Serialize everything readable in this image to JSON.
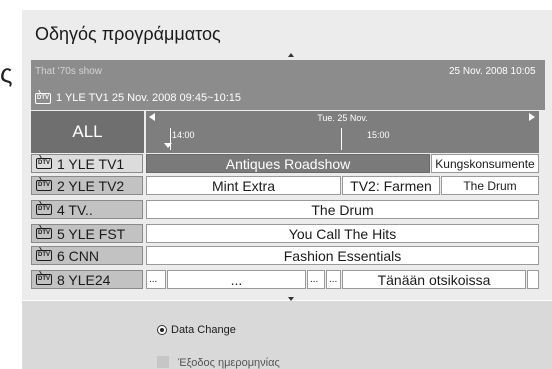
{
  "title": "Οδηγός προγράμματος",
  "left_glyph": "ς",
  "info": {
    "show": "That '70s show",
    "datetime": "25 Nov. 2008 10:05",
    "channel_line": "1 YLE TV1 25 Nov. 2008 09:45~10:15"
  },
  "filter": {
    "all_label": "ALL"
  },
  "timeline": {
    "date": "Tue. 25 Nov.",
    "times": [
      "14:00",
      "15:00"
    ]
  },
  "dtv_icon_text": "DTV",
  "channels": [
    {
      "label": "1  YLE TV1",
      "icon": "dtv-icon"
    },
    {
      "label": "2  YLE TV2",
      "icon": "dtv-icon"
    },
    {
      "label": "4  TV..",
      "icon": "dtv-icon"
    },
    {
      "label": "5  YLE FST",
      "icon": "dtv-icon"
    },
    {
      "label": "6  CNN",
      "icon": "dtv-icon"
    },
    {
      "label": "8  YLE24",
      "icon": "dtv-icon"
    }
  ],
  "programs": {
    "row1": [
      "Antiques Roadshow",
      "Kungskonsumente"
    ],
    "row2": [
      "Mint Extra",
      "TV2: Farmen",
      "The Drum"
    ],
    "row3": [
      "The Drum"
    ],
    "row4": [
      "You Call The Hits"
    ],
    "row5": [
      "Fashion Essentials"
    ],
    "row6": [
      "...",
      "...",
      "...",
      "...",
      "Tänään otsikoissa",
      ""
    ]
  },
  "options": {
    "data_change": "Data Change",
    "date_exit": "Έξοδος ημερομηνίας"
  },
  "colors": {
    "highlight": "#7a7a7a",
    "header": "#8c8c8c",
    "panel": "#ececec"
  }
}
